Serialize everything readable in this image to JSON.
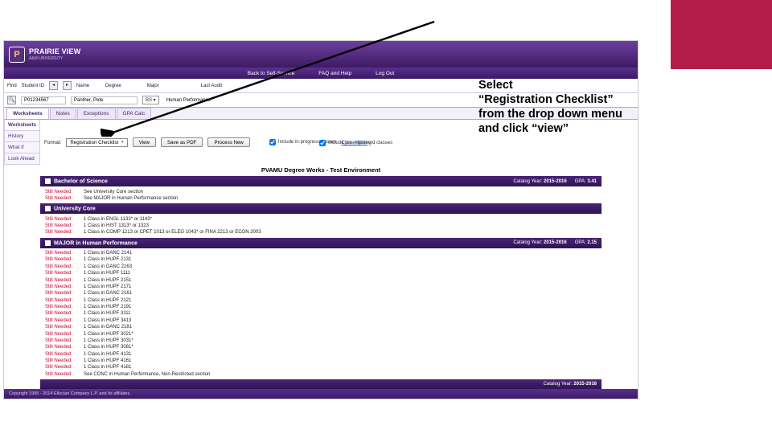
{
  "accent_color": "#b31e49",
  "logo": {
    "glyph": "P",
    "name": "PRAIRIE VIEW",
    "sub": "A&M UNIVERSITY"
  },
  "topnav": {
    "back": "Back to Self-Service",
    "faq": "FAQ and Help",
    "logout": "Log Out"
  },
  "info": {
    "student_id_lbl": "Student ID",
    "student_id": "P01234567",
    "name_lbl": "Name",
    "name_val": "Panther, Pete",
    "degree_lbl": "Degree",
    "degree_val": "BS",
    "major_lbl": "Major",
    "major_val": "Human Performance",
    "last_audit_lbl": "Last Audit"
  },
  "tabs": {
    "worksheets": "Worksheets",
    "notes": "Notes",
    "exceptions": "Exceptions",
    "gpa": "GPA Calc"
  },
  "side": {
    "ws": "Worksheets",
    "whatif": "What If",
    "look": "Look Ahead",
    "history": "History"
  },
  "ws": {
    "format_lbl": "Format:",
    "format_val": "Registration Checklist",
    "view_btn": "View",
    "pdf_btn": "Save as PDF",
    "process_btn": "Process New",
    "chk1": "Include in-progress classes",
    "chk2": "Include pre-registered classes",
    "class_history": "Class History"
  },
  "env_title": "PVAMU Degree Works - Test Environment",
  "blocks": {
    "bs": {
      "title": "Bachelor of Science",
      "meta1_lbl": "Catalog Year:",
      "meta1_val": "2015-2016",
      "meta2_lbl": "GPA:",
      "meta2_val": "3.41",
      "rows": [
        {
          "sn": "Still Needed:",
          "t": "See University Core section"
        },
        {
          "sn": "Still Needed:",
          "t": "See MAJOR in Human Performance section"
        }
      ]
    },
    "uc": {
      "title": "University Core",
      "rows": [
        {
          "sn": "Still Needed:",
          "t": "1 Class in ENGL 1133* or 1143*"
        },
        {
          "sn": "Still Needed:",
          "t": "1 Class in HIST 1313* or 1323"
        },
        {
          "sn": "Still Needed:",
          "t": "1 Class in COMP 1213 or CPET 1013 or ELEG 1043* or FINA 2213 or ECON 2003"
        }
      ]
    },
    "mj": {
      "title": "MAJOR in Human Performance",
      "meta1_lbl": "Catalog Year:",
      "meta1_val": "2015-2016",
      "meta2_lbl": "GPA:",
      "meta2_val": "2.15",
      "rows": [
        {
          "sn": "Still Needed:",
          "t": "1 Class in DANC 2141"
        },
        {
          "sn": "Still Needed:",
          "t": "1 Class in HUPF 2131"
        },
        {
          "sn": "Still Needed:",
          "t": "1 Class in DANC 2163"
        },
        {
          "sn": "Still Needed:",
          "t": "1 Class in HUPF 1111"
        },
        {
          "sn": "Still Needed:",
          "t": "1 Class in HUPF 2151"
        },
        {
          "sn": "Still Needed:",
          "t": "1 Class in HUPF 2171"
        },
        {
          "sn": "Still Needed:",
          "t": "1 Class in DANC 2161"
        },
        {
          "sn": "Still Needed:",
          "t": "1 Class in HUPF 2121"
        },
        {
          "sn": "Still Needed:",
          "t": "1 Class in HUPF 2191"
        },
        {
          "sn": "Still Needed:",
          "t": "1 Class in HUPF 3111"
        },
        {
          "sn": "Still Needed:",
          "t": "1 Class in HUPF 3413"
        },
        {
          "sn": "Still Needed:",
          "t": "1 Class in DANC 2181"
        },
        {
          "sn": "Still Needed:",
          "t": "1 Class in HUPF 3021*"
        },
        {
          "sn": "Still Needed:",
          "t": "1 Class in HUPF 3031*"
        },
        {
          "sn": "Still Needed:",
          "t": "1 Class in HUPF 3081*"
        },
        {
          "sn": "Still Needed:",
          "t": "1 Class in HUPF 4131"
        },
        {
          "sn": "Still Needed:",
          "t": "1 Class in HUPF 4161"
        },
        {
          "sn": "Still Needed:",
          "t": "1 Class in HUPF 4181"
        },
        {
          "sn": "Still Needed:",
          "t": "See CONC in Human Performance, Non-Restricted section"
        }
      ]
    },
    "conc": {
      "meta1_lbl": "Catalog Year:",
      "meta1_val": "2015-2016"
    }
  },
  "footer": {
    "copyright": "Copyright 1995 - 2014 Ellucian Company L.P. and its affiliates."
  },
  "callout": {
    "l1": "Select",
    "l2": "“Registration Checklist”",
    "l3": "from the drop down menu",
    "l4": "and click “view”"
  }
}
